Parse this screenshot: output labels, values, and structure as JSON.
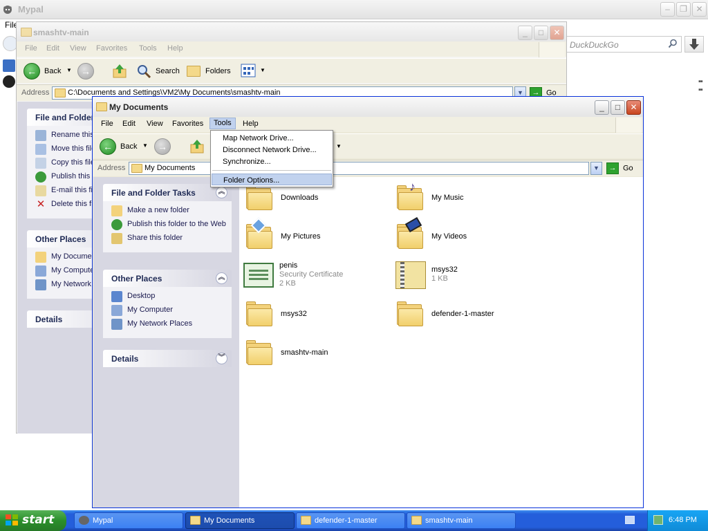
{
  "mypal": {
    "title": "Mypal",
    "menu_file": "File",
    "search_placeholder": "DuckDuckGo"
  },
  "smashtv_window": {
    "title": "smashtv-main",
    "menu": [
      "File",
      "Edit",
      "View",
      "Favorites",
      "Tools",
      "Help"
    ],
    "toolbar": {
      "back": "Back",
      "search": "Search",
      "folders": "Folders"
    },
    "address_label": "Address",
    "address_value": "C:\\Documents and Settings\\VM2\\My Documents\\smashtv-main",
    "go": "Go",
    "tasks_title": "File and Folder Tasks",
    "tasks": [
      "Rename this file",
      "Move this file",
      "Copy this file",
      "Publish this file",
      "E-mail this file",
      "Delete this file"
    ],
    "other_title": "Other Places",
    "other": [
      "My Documents",
      "My Computer",
      "My Network Places"
    ],
    "details_title": "Details"
  },
  "mydocs_window": {
    "title": "My Documents",
    "menu": [
      "File",
      "Edit",
      "View",
      "Favorites",
      "Tools",
      "Help"
    ],
    "toolbar": {
      "back": "Back"
    },
    "address_label": "Address",
    "address_value": "My Documents",
    "go": "Go",
    "tasks_title": "File and Folder Tasks",
    "tasks": [
      "Make a new folder",
      "Publish this folder to the Web",
      "Share this folder"
    ],
    "other_title": "Other Places",
    "other": [
      "Desktop",
      "My Computer",
      "My Network Places"
    ],
    "details_title": "Details",
    "items": [
      {
        "name": "Downloads",
        "icon": "folder-icon"
      },
      {
        "name": "My Music",
        "icon": "music-folder-icon"
      },
      {
        "name": "My Pictures",
        "icon": "pictures-folder-icon"
      },
      {
        "name": "My Videos",
        "icon": "videos-folder-icon"
      },
      {
        "name": "penis",
        "type": "Security Certificate",
        "size": "2 KB",
        "icon": "certificate-icon"
      },
      {
        "name": "msys32",
        "size": "1 KB",
        "icon": "zip-file-icon"
      },
      {
        "name": "msys32",
        "icon": "folder-icon"
      },
      {
        "name": "defender-1-master",
        "icon": "folder-icon"
      },
      {
        "name": "smashtv-main",
        "icon": "folder-icon"
      }
    ]
  },
  "tools_menu": {
    "items": [
      "Map Network Drive...",
      "Disconnect Network Drive...",
      "Synchronize...",
      "Folder Options..."
    ],
    "highlighted": "Folder Options..."
  },
  "taskbar": {
    "start": "start",
    "buttons": [
      "Mypal",
      "My Documents",
      "defender-1-master",
      "smashtv-main"
    ],
    "active": "My Documents",
    "clock": "6:48 PM"
  },
  "colors": {
    "taskbar_blue": "#245edb",
    "start_green": "#2b8f2b",
    "menu_highlight": "#c1d2ee",
    "close_red": "#c8451f"
  }
}
